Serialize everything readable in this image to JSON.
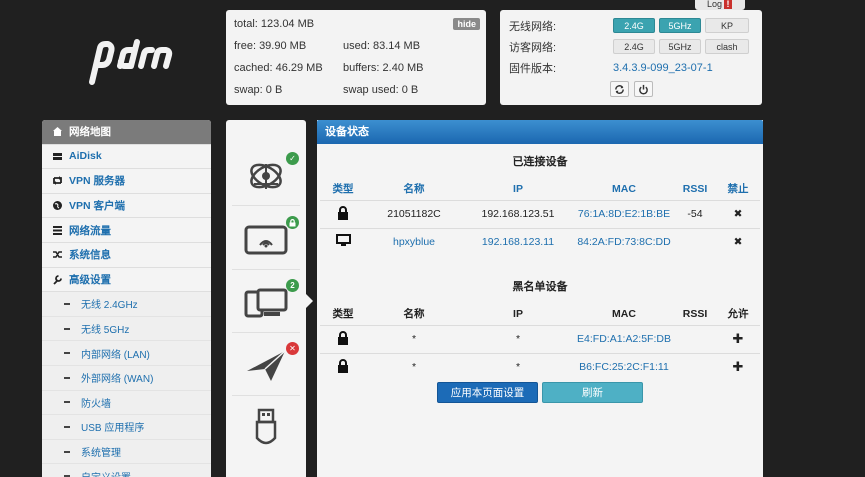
{
  "logo": {
    "text": "pdcn",
    "icon": "pdcn-logo"
  },
  "log_tab": {
    "label": "Log",
    "alert": "!"
  },
  "memory": {
    "hide_label": "hide",
    "total": "total: 123.04 MB",
    "free": "free: 39.90 MB",
    "used": "used: 83.14 MB",
    "cached": "cached: 46.29 MB",
    "buffers": "buffers: 2.40 MB",
    "swap": "swap: 0 B",
    "swap_used": "swap used: 0 B"
  },
  "network": {
    "wireless_label": "无线网络:",
    "wireless_buttons": [
      "2.4G",
      "5GHz",
      "KP"
    ],
    "guest_label": "访客网络:",
    "guest_buttons": [
      "2.4G",
      "5GHz",
      "clash"
    ],
    "firmware_label": "固件版本:",
    "firmware_value": "3.4.3.9-099_23-07-1",
    "accent": "#3ba3b0"
  },
  "sidebar": {
    "items": [
      {
        "label": "网络地图",
        "icon": "network-map-icon"
      },
      {
        "label": "AiDisk",
        "icon": "disk-icon"
      },
      {
        "label": "VPN 服务器",
        "icon": "vpn-server-icon"
      },
      {
        "label": "VPN 客户端",
        "icon": "globe-icon"
      },
      {
        "label": "网络流量",
        "icon": "traffic-icon"
      },
      {
        "label": "系统信息",
        "icon": "shuffle-icon"
      },
      {
        "label": "高级设置",
        "icon": "wrench-icon"
      }
    ],
    "subitems": [
      "无线 2.4GHz",
      "无线 5GHz",
      "内部网络 (LAN)",
      "外部网络 (WAN)",
      "防火墙",
      "USB 应用程序",
      "系统管理",
      "自定义设置"
    ]
  },
  "middle": {
    "badges": [
      "✓",
      "🔒",
      "2",
      "✕"
    ],
    "icons": [
      "internet-globe-icon",
      "wireless-tablet-icon",
      "devices-icon",
      "plane-icon",
      "usb-icon"
    ]
  },
  "main": {
    "title": "设备状态",
    "connected_title": "已连接设备",
    "connected_headers": [
      "类型",
      "名称",
      "IP",
      "MAC",
      "RSSI",
      "禁止"
    ],
    "connected_rows": [
      {
        "type_icon": "lock-icon",
        "name": "21051182C",
        "ip": "192.168.123.51",
        "mac": "76:1A:8D:E2:1B:BE",
        "rssi": "-54",
        "action": "✖"
      },
      {
        "type_icon": "monitor-icon",
        "name": "hpxyblue",
        "ip": "192.168.123.11",
        "mac": "84:2A:FD:73:8C:DD",
        "rssi": "",
        "action": "✖"
      }
    ],
    "blacklist_title": "黑名单设备",
    "blacklist_headers": [
      "类型",
      "名称",
      "IP",
      "MAC",
      "RSSI",
      "允许"
    ],
    "blacklist_rows": [
      {
        "type_icon": "lock-icon",
        "name": "*",
        "ip": "*",
        "mac": "E4:FD:A1:A2:5F:DB",
        "rssi": "",
        "action": "✚"
      },
      {
        "type_icon": "lock-icon",
        "name": "*",
        "ip": "*",
        "mac": "B6:FC:25:2C:F1:11",
        "rssi": "",
        "action": "✚"
      }
    ],
    "apply_label": "应用本页面设置",
    "refresh_label": "刷新"
  }
}
